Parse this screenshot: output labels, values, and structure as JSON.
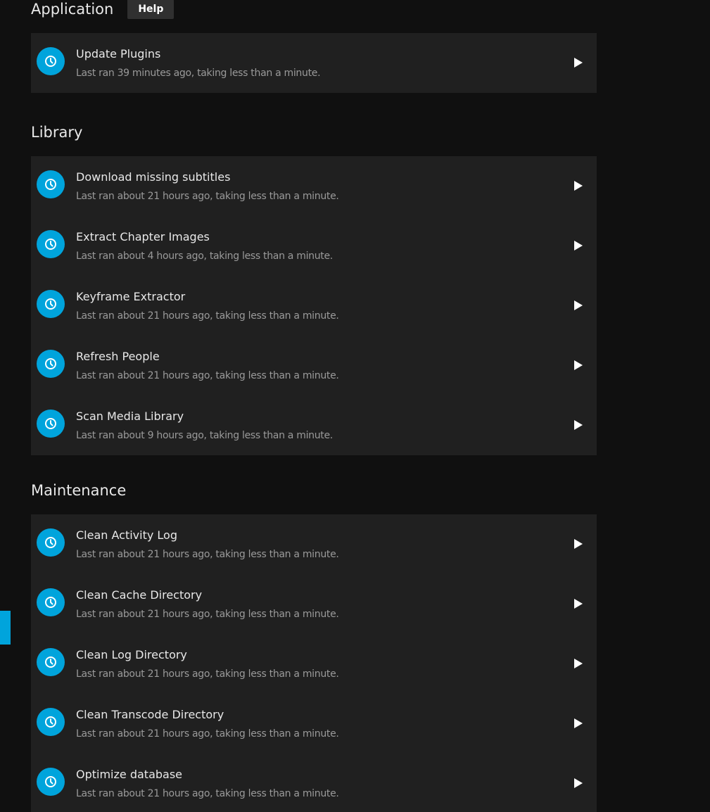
{
  "colors": {
    "accent": "#00a4dc",
    "background": "#101010",
    "card": "#202020"
  },
  "sections": [
    {
      "title": "Application",
      "help_label": "Help",
      "tasks": [
        {
          "name": "Update Plugins",
          "status": "Last ran 39 minutes ago, taking less than a minute.",
          "icon": "clock-icon",
          "action_icon": "play-icon"
        }
      ]
    },
    {
      "title": "Library",
      "tasks": [
        {
          "name": "Download missing subtitles",
          "status": "Last ran about 21 hours ago, taking less than a minute.",
          "icon": "clock-icon",
          "action_icon": "play-icon"
        },
        {
          "name": "Extract Chapter Images",
          "status": "Last ran about 4 hours ago, taking less than a minute.",
          "icon": "clock-icon",
          "action_icon": "play-icon"
        },
        {
          "name": "Keyframe Extractor",
          "status": "Last ran about 21 hours ago, taking less than a minute.",
          "icon": "clock-icon",
          "action_icon": "play-icon"
        },
        {
          "name": "Refresh People",
          "status": "Last ran about 21 hours ago, taking less than a minute.",
          "icon": "clock-icon",
          "action_icon": "play-icon"
        },
        {
          "name": "Scan Media Library",
          "status": "Last ran about 9 hours ago, taking less than a minute.",
          "icon": "clock-icon",
          "action_icon": "play-icon"
        }
      ]
    },
    {
      "title": "Maintenance",
      "tasks": [
        {
          "name": "Clean Activity Log",
          "status": "Last ran about 21 hours ago, taking less than a minute.",
          "icon": "clock-icon",
          "action_icon": "play-icon"
        },
        {
          "name": "Clean Cache Directory",
          "status": "Last ran about 21 hours ago, taking less than a minute.",
          "icon": "clock-icon",
          "action_icon": "play-icon"
        },
        {
          "name": "Clean Log Directory",
          "status": "Last ran about 21 hours ago, taking less than a minute.",
          "icon": "clock-icon",
          "action_icon": "play-icon"
        },
        {
          "name": "Clean Transcode Directory",
          "status": "Last ran about 21 hours ago, taking less than a minute.",
          "icon": "clock-icon",
          "action_icon": "play-icon"
        },
        {
          "name": "Optimize database",
          "status": "Last ran about 21 hours ago, taking less than a minute.",
          "icon": "clock-icon",
          "action_icon": "play-icon"
        }
      ]
    }
  ]
}
